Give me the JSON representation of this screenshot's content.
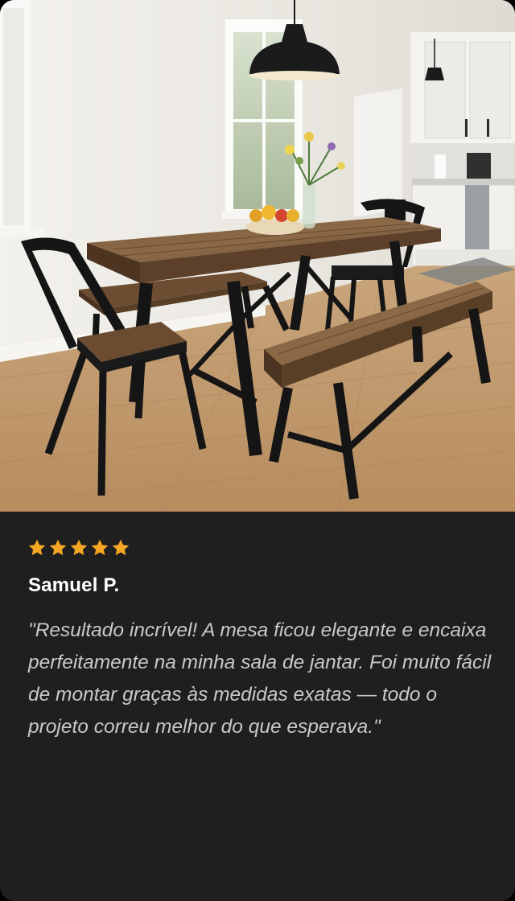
{
  "review": {
    "rating": 5,
    "rating_max": 5,
    "reviewer_name": "Samuel P.",
    "text": "\"Resultado incrível! A mesa ficou elegante e encaixa perfeitamente na minha sala de jantar. Foi muito fácil de montar graças às medidas exatas — todo o projeto correu melhor do que esperava.\""
  },
  "photo": {
    "subject": "dining-room-table-benches-chairs-photo"
  },
  "colors": {
    "card_background": "#1f1f1f",
    "star": "#f5a623",
    "name_text": "#ffffff",
    "quote_text": "#c9c9c9"
  }
}
